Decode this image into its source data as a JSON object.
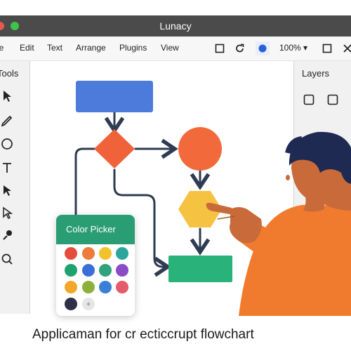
{
  "window": {
    "title": "Lunacy"
  },
  "menu": {
    "items": [
      "le",
      "Edit",
      "Text",
      "Arrange",
      "Plugins",
      "View"
    ]
  },
  "toolbar": {
    "zoom": "100%"
  },
  "left_panel": {
    "title": "Tools"
  },
  "right_panel": {
    "title": "Layers"
  },
  "color_picker": {
    "title": "Color Picker",
    "swatches": [
      "#e44d3a",
      "#ee7a3c",
      "#f2c12e",
      "#2ba69a",
      "#1fa36e",
      "#3b6fd8",
      "#2fa37c",
      "#8a4bc9",
      "#f2a72b",
      "#8bb13b",
      "#3a7fd8",
      "#e45b6a",
      "#2f3047"
    ]
  },
  "flowchart": {
    "colors": {
      "rect": "#4c7bdc",
      "diamond": "#f0623a",
      "circle": "#f26a3c",
      "hexagon": "#f5c242",
      "rect2": "#2ab27b",
      "arrow": "#2f3b52"
    }
  },
  "caption": "Applicaman for cr ecticcrupt flowchart"
}
